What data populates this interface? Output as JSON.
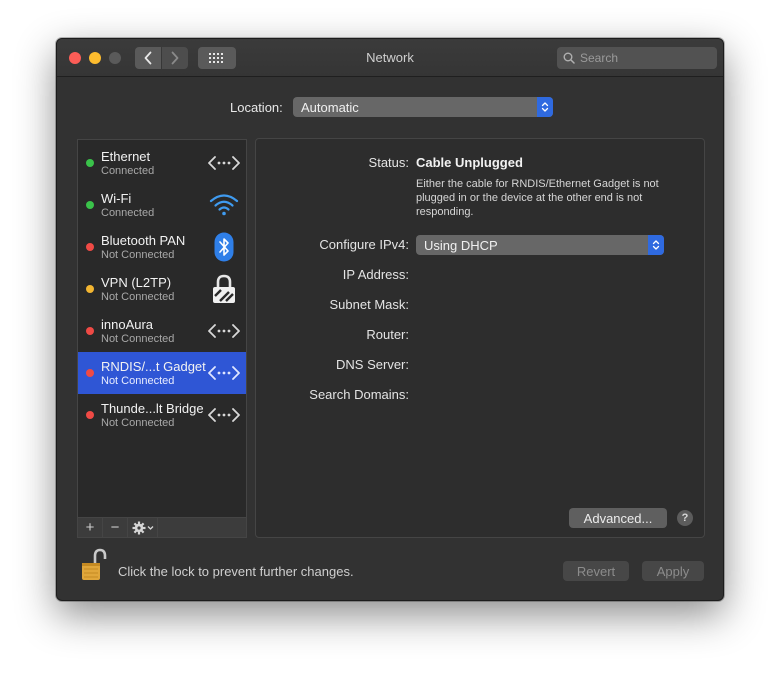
{
  "window": {
    "title": "Network"
  },
  "toolbar": {
    "search_placeholder": "Search"
  },
  "location": {
    "label": "Location:",
    "value": "Automatic"
  },
  "services": [
    {
      "name": "Ethernet",
      "status": "Connected",
      "dot": "#3ac24a",
      "icon": "ethernet-icon"
    },
    {
      "name": "Wi-Fi",
      "status": "Connected",
      "dot": "#3ac24a",
      "icon": "wifi-icon"
    },
    {
      "name": "Bluetooth PAN",
      "status": "Not Connected",
      "dot": "#ef4a45",
      "icon": "bluetooth-icon"
    },
    {
      "name": "VPN (L2TP)",
      "status": "Not Connected",
      "dot": "#f2b531",
      "icon": "vpn-lock-icon"
    },
    {
      "name": "innoAura",
      "status": "Not Connected",
      "dot": "#ef4a45",
      "icon": "ethernet-icon"
    },
    {
      "name": "RNDIS/...t Gadget",
      "status": "Not Connected",
      "dot": "#ef4a45",
      "icon": "ethernet-icon",
      "selected": true
    },
    {
      "name": "Thunde...lt Bridge",
      "status": "Not Connected",
      "dot": "#ef4a45",
      "icon": "ethernet-icon"
    }
  ],
  "sidebar_footer": {
    "add": "+",
    "remove": "−"
  },
  "detail": {
    "status_label": "Status:",
    "status_value": "Cable Unplugged",
    "status_description": "Either the cable for RNDIS/Ethernet Gadget is not plugged in or the device at the other end is not responding.",
    "configure_label": "Configure IPv4:",
    "configure_value": "Using DHCP",
    "ip_label": "IP Address:",
    "subnet_label": "Subnet Mask:",
    "router_label": "Router:",
    "dns_label": "DNS Server:",
    "search_domains_label": "Search Domains:",
    "advanced_label": "Advanced...",
    "help_label": "?"
  },
  "footer": {
    "lock_text": "Click the lock to prevent further changes.",
    "revert_label": "Revert",
    "apply_label": "Apply"
  },
  "colors": {
    "accent": "#2f56d5",
    "select_accent": "#2f6ae0",
    "lock": "#e0a63a"
  }
}
